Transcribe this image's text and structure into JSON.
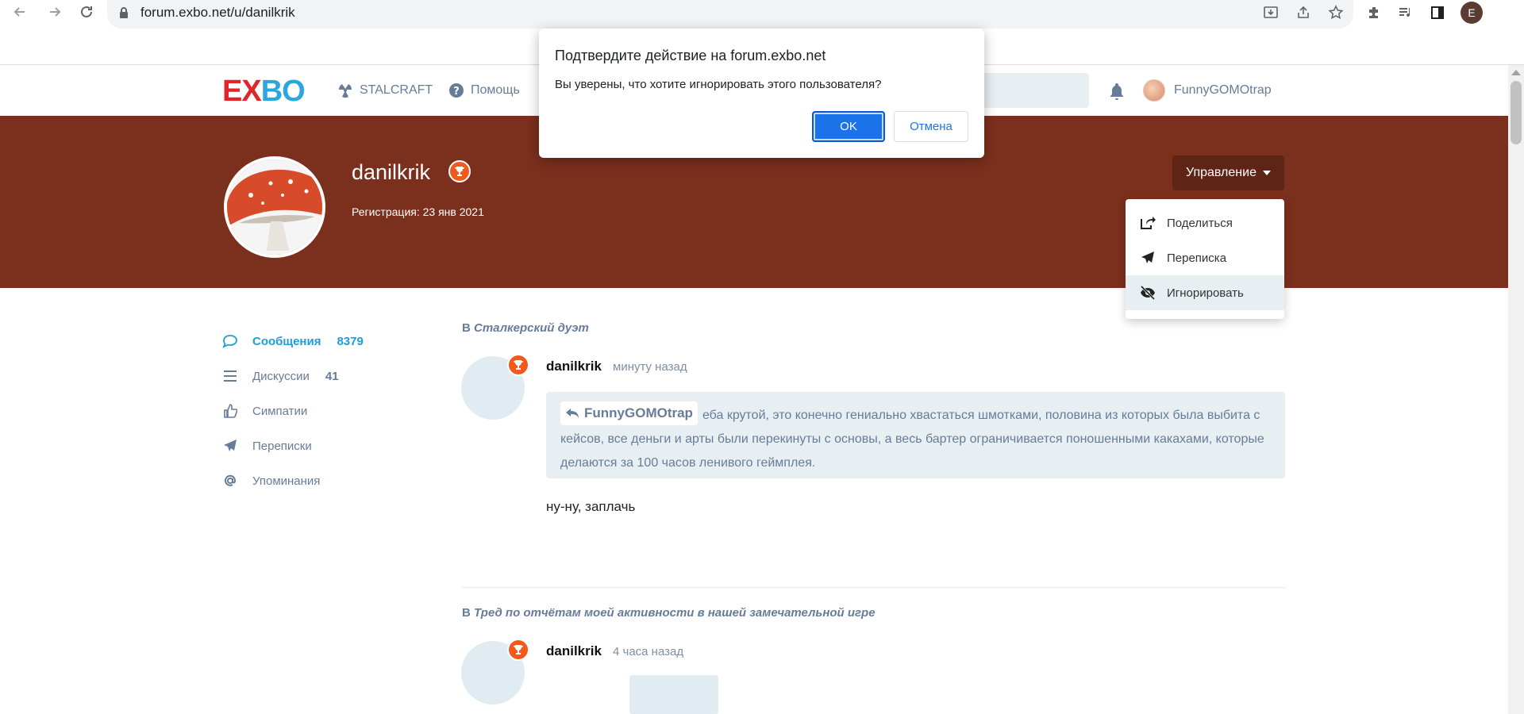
{
  "browser": {
    "url": "forum.exbo.net/u/danilkrik",
    "profile_initial": "E"
  },
  "header": {
    "logo_e": "E",
    "logo_x": "X",
    "logo_bo": "BO",
    "nav": [
      {
        "label": "STALCRAFT",
        "icon": "radiation-icon"
      },
      {
        "label": "Помощь",
        "icon": "help-icon"
      }
    ],
    "current_user": "FunnyGOMOtrap"
  },
  "profile": {
    "username": "danilkrik",
    "registration": "Регистрация: 23 янв 2021",
    "manage_label": "Управление"
  },
  "dropdown": {
    "items": [
      {
        "label": "Поделиться",
        "icon": "share-icon"
      },
      {
        "label": "Переписка",
        "icon": "paper-plane-icon"
      },
      {
        "label": "Игнорировать",
        "icon": "eye-slash-icon"
      }
    ]
  },
  "sidebar": {
    "items": [
      {
        "label": "Сообщения",
        "count": "8379",
        "icon": "comment-icon"
      },
      {
        "label": "Дискуссии",
        "count": "41",
        "icon": "list-icon"
      },
      {
        "label": "Симпатии",
        "count": "",
        "icon": "thumbs-up-icon"
      },
      {
        "label": "Переписки",
        "count": "",
        "icon": "paper-plane-icon"
      },
      {
        "label": "Упоминания",
        "count": "",
        "icon": "at-icon"
      }
    ]
  },
  "posts": [
    {
      "context_prefix": "В",
      "discussion": "Сталкерский дуэт",
      "author": "danilkrik",
      "time": "минуту назад",
      "quote_user": "FunnyGOMOtrap",
      "quote_text": "еба крутой, это конечно гениально хвастаться шмотками, половина из которых была выбита с кейсов, все деньги и арты были перекинуты с основы, а весь бартер ограничивается поношенными какахами, которые делаются за 100 часов ленивого геймплея.",
      "body": "ну-ну, заплачь"
    },
    {
      "context_prefix": "В",
      "discussion": "Тред по отчётам моей активности в нашей замечательной игре",
      "author": "danilkrik",
      "time": "4 часа назад"
    }
  ],
  "dialog": {
    "title": "Подтвердите действие на forum.exbo.net",
    "message": "Вы уверены, что хотите игнорировать этого пользователя?",
    "ok": "OK",
    "cancel": "Отмена"
  }
}
